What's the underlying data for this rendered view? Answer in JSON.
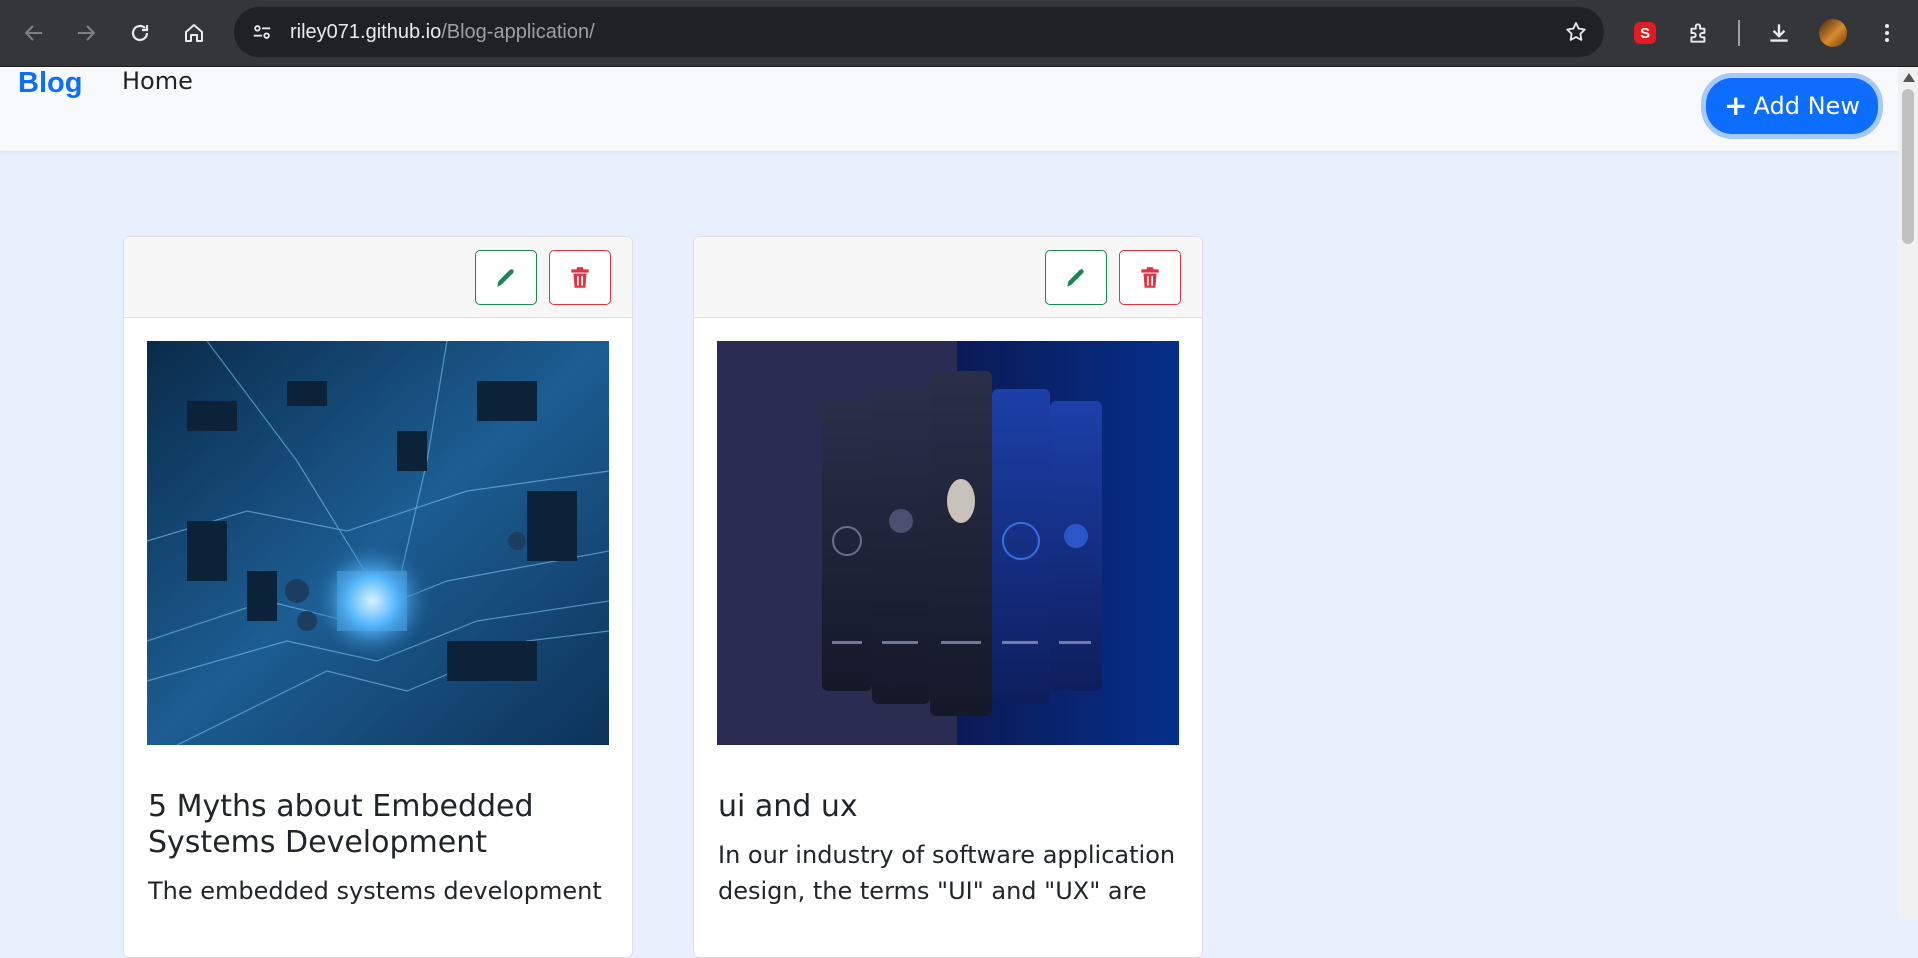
{
  "browser": {
    "url_host": "riley071.github.io",
    "url_path": "/Blog-application/",
    "extension_badge": "S"
  },
  "navbar": {
    "brand": "Blog",
    "home": "Home",
    "add_new": "Add New"
  },
  "posts": [
    {
      "title": "5 Myths about Embedded Systems Development",
      "excerpt": "The embedded systems development",
      "image": "circuit-board-image"
    },
    {
      "title": "ui and ux",
      "excerpt": "In our industry of software application design, the terms \"UI\" and \"UX\" are",
      "image": "mobile-app-screens-image"
    }
  ],
  "colors": {
    "primary": "#0d6efd",
    "edit": "#198754",
    "delete": "#dc3545",
    "page_bg": "#e9f0fd"
  }
}
